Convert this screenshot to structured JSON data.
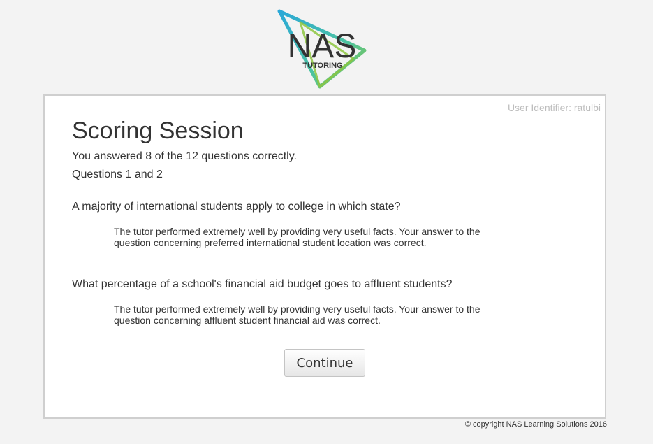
{
  "logo": {
    "wordmark": "NAS",
    "subtext": "TUTORING",
    "colors": [
      "#2aa8d8",
      "#4cc3a0",
      "#8dc63f"
    ]
  },
  "user_identifier": "User Identifier: ratulbi",
  "title": "Scoring Session",
  "summary": "You answered 8 of the 12 questions correctly.",
  "question_range": "Questions 1 and 2",
  "questions": [
    {
      "text": "A majority of international students apply to college in which state?",
      "feedback": "The tutor performed extremely well by providing very useful facts. Your answer to the question concerning preferred international student location was correct."
    },
    {
      "text": "What percentage of a school's financial aid budget goes to affluent students?",
      "feedback": "The tutor performed extremely well by providing very useful facts. Your answer to the question concerning affluent student financial aid was correct."
    }
  ],
  "continue_label": "Continue",
  "footer": "© copyright NAS Learning Solutions 2016"
}
